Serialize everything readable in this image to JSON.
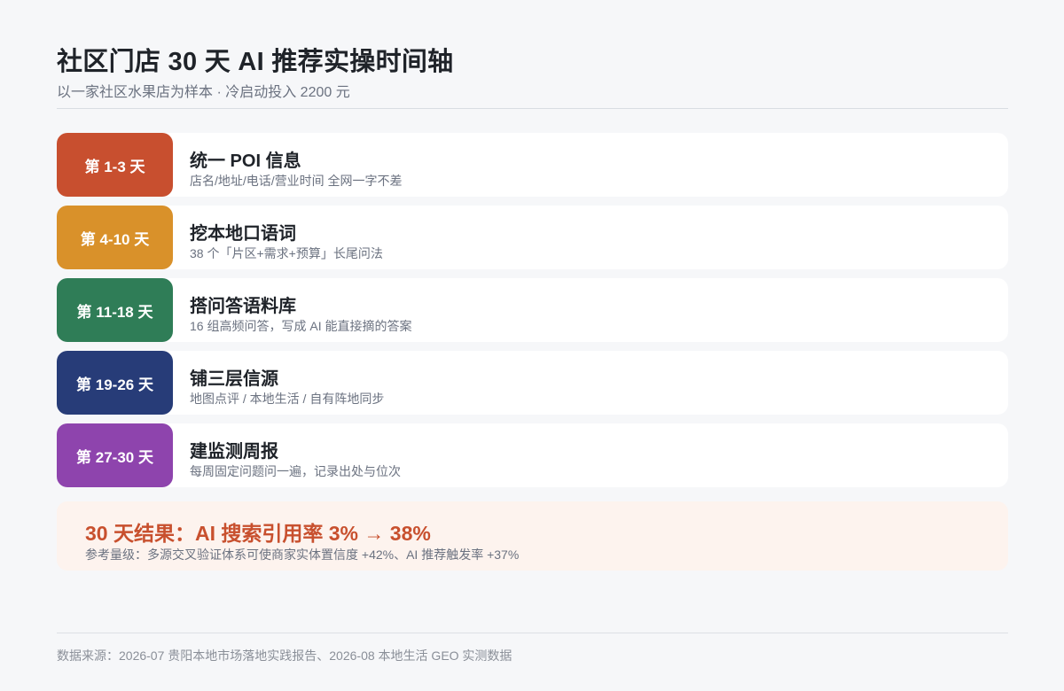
{
  "header": {
    "title": "社区门店 30 天 AI 推荐实操时间轴",
    "subtitle": "以一家社区水果店为样本 · 冷启动投入 2200 元"
  },
  "steps": [
    {
      "day_label": "第 1-3 天",
      "title": "统一 POI 信息",
      "description": "店名/地址/电话/营业时间 全网一字不差",
      "color": "#c84f2f"
    },
    {
      "day_label": "第 4-10 天",
      "title": "挖本地口语词",
      "description": "38 个「片区+需求+预算」长尾问法",
      "color": "#d9912a"
    },
    {
      "day_label": "第 11-18 天",
      "title": "搭问答语料库",
      "description": "16 组高频问答，写成 AI 能直接摘的答案",
      "color": "#2f7d57"
    },
    {
      "day_label": "第 19-26 天",
      "title": "铺三层信源",
      "description": "地图点评 / 本地生活 / 自有阵地同步",
      "color": "#273c78"
    },
    {
      "day_label": "第 27-30 天",
      "title": "建监测周报",
      "description": "每周固定问题问一遍，记录出处与位次",
      "color": "#8e44ad"
    }
  ],
  "result": {
    "headline": "30 天结果：AI 搜索引用率 3% → 38%",
    "note": "参考量级：多源交叉验证体系可使商家实体置信度 +42%、AI 推荐触发率 +37%"
  },
  "footer": {
    "source": "数据来源：2026-07 贵阳本地市场落地实践报告、2026-08 本地生活 GEO 实测数据"
  }
}
